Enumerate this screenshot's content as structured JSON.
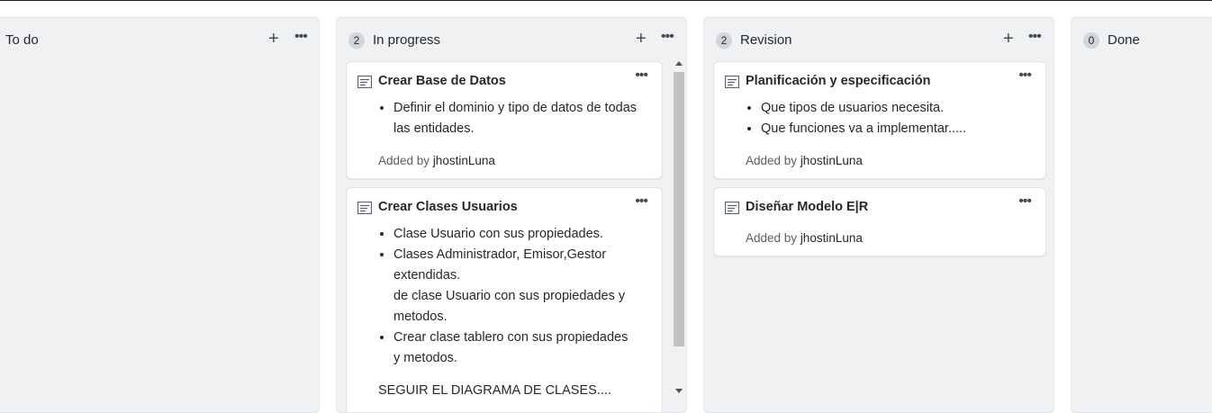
{
  "columns": [
    {
      "id": "todo",
      "count": "",
      "title": "To do",
      "cards": []
    },
    {
      "id": "inprogress",
      "count": "2",
      "title": "In progress",
      "cards": [
        {
          "title": "Crear Base de Datos",
          "items": [
            "Definir el dominio y tipo de datos de todas las entidades."
          ],
          "added_prefix": "Added by",
          "added_user": "jhostinLuna"
        },
        {
          "title": "Crear Clases Usuarios",
          "items": [
            "Clase Usuario con sus propiedades.",
            "Clases Administrador, Emisor,Gestor extendidas.",
            "Crear clase tablero con sus propiedades y metodos."
          ],
          "item2_extra": "de clase Usuario con sus propiedades y metodos.",
          "footer_text": "SEGUIR EL DIAGRAMA DE CLASES...."
        }
      ]
    },
    {
      "id": "revision",
      "count": "2",
      "title": "Revision",
      "cards": [
        {
          "title": "Planificación y especificación",
          "items": [
            "Que tipos de usuarios necesita.",
            "Que funciones va a implementar....."
          ],
          "added_prefix": "Added by",
          "added_user": "jhostinLuna"
        },
        {
          "title": "Diseñar Modelo E|R",
          "added_prefix": "Added by",
          "added_user": "jhostinLuna"
        }
      ]
    },
    {
      "id": "done",
      "count": "0",
      "title": "Done",
      "cards": []
    }
  ],
  "icons": {
    "add": "+",
    "menu": "•••"
  }
}
